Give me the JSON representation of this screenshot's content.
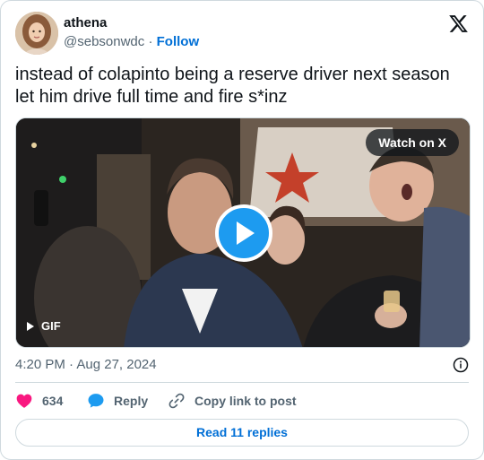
{
  "author": {
    "display_name": "athena",
    "handle": "@sebsonwdc",
    "separator": "·",
    "follow_label": "Follow"
  },
  "tweet": {
    "text": "instead of colapinto being a reserve driver next season let him drive full time and fire s*inz"
  },
  "media": {
    "watch_label": "Watch on X",
    "gif_label": "GIF"
  },
  "meta": {
    "timestamp": "4:20 PM · Aug 27, 2024"
  },
  "actions": {
    "like_count": "634",
    "reply_label": "Reply",
    "copy_link_label": "Copy link to post"
  },
  "footer": {
    "read_replies_label": "Read 11 replies"
  },
  "icons": {
    "brand": "x-logo-icon",
    "like": "heart-icon",
    "reply": "speech-bubble-icon",
    "copy": "link-icon",
    "info": "info-icon",
    "play": "play-icon"
  },
  "colors": {
    "link_blue": "#006fd6",
    "play_blue": "#1d9bf0",
    "like_pink": "#f91880",
    "text_primary": "#0f1419",
    "text_secondary": "#536471"
  }
}
